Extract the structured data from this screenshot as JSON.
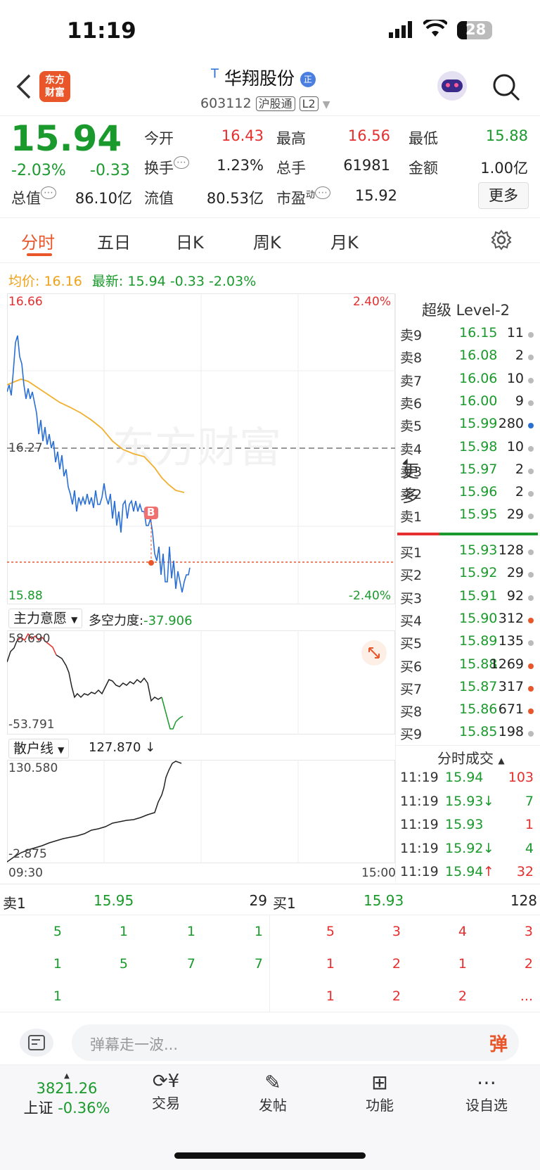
{
  "status_bar": {
    "time": "11:19",
    "battery": "28"
  },
  "header": {
    "title_prefix": "T",
    "title": "华翔股份",
    "badge": "正",
    "code": "603112",
    "tag1": "沪股通",
    "tag2": "L2",
    "logo_line1": "东方",
    "logo_line2": "财富"
  },
  "quote": {
    "price": "15.94",
    "change_pct": "-2.03%",
    "change": "-0.33",
    "open_label": "今开",
    "open": "16.43",
    "high_label": "最高",
    "high": "16.56",
    "low_label": "最低",
    "low": "15.88",
    "turnover_label": "换手",
    "turnover": "1.23%",
    "volume_label": "总手",
    "volume": "61981",
    "amount_label": "金额",
    "amount": "1.00亿",
    "mcap_label": "总值",
    "mcap": "86.10亿",
    "float_label": "流值",
    "float": "80.53亿",
    "pe_label": "市盈",
    "pe_sup": "动",
    "pe": "15.92",
    "more_button": "更多"
  },
  "tabs": [
    "分时",
    "五日",
    "日K",
    "周K",
    "月K",
    "更多"
  ],
  "chart_info": {
    "avg_label": "均价:",
    "avg": "16.16",
    "latest_label": "最新:",
    "latest": "15.94",
    "change": "-0.33",
    "change_pct": "-2.03%",
    "y_top": "16.66",
    "y_mid": "16.27",
    "y_bottom": "15.88",
    "pct_top": "2.40%",
    "pct_bottom": "-2.40%",
    "watermark": "东方财富",
    "buy_marker": "B",
    "x_start": "09:30",
    "x_end": "15:00"
  },
  "indicator1": {
    "name": "主力意愿",
    "label": "多空力度:",
    "value": "-37.906",
    "y_top": "58.690",
    "y_bottom": "-53.791"
  },
  "indicator2": {
    "name": "散户线",
    "value": "127.870 ↓",
    "y_top": "130.580",
    "y_bottom": "-2.875"
  },
  "order_book": {
    "title": "超级 Level-2",
    "asks": [
      {
        "label": "卖9",
        "price": "16.15",
        "vol": "11",
        "dot": "#bbbbbb"
      },
      {
        "label": "卖8",
        "price": "16.08",
        "vol": "2",
        "dot": "#bbbbbb"
      },
      {
        "label": "卖7",
        "price": "16.06",
        "vol": "10",
        "dot": "#bbbbbb"
      },
      {
        "label": "卖6",
        "price": "16.00",
        "vol": "9",
        "dot": "#bbbbbb"
      },
      {
        "label": "卖5",
        "price": "15.99",
        "vol": "280",
        "dot": "#2a6fd6"
      },
      {
        "label": "卖4",
        "price": "15.98",
        "vol": "10",
        "dot": "#bbbbbb"
      },
      {
        "label": "卖3",
        "price": "15.97",
        "vol": "2",
        "dot": "#bbbbbb"
      },
      {
        "label": "卖2",
        "price": "15.96",
        "vol": "2",
        "dot": "#bbbbbb"
      },
      {
        "label": "卖1",
        "price": "15.95",
        "vol": "29",
        "dot": "#bbbbbb"
      }
    ],
    "bids": [
      {
        "label": "买1",
        "price": "15.93",
        "vol": "128",
        "dot": "#bbbbbb"
      },
      {
        "label": "买2",
        "price": "15.92",
        "vol": "29",
        "dot": "#bbbbbb"
      },
      {
        "label": "买3",
        "price": "15.91",
        "vol": "92",
        "dot": "#bbbbbb"
      },
      {
        "label": "买4",
        "price": "15.90",
        "vol": "312",
        "dot": "#e8562a"
      },
      {
        "label": "买5",
        "price": "15.89",
        "vol": "135",
        "dot": "#bbbbbb"
      },
      {
        "label": "买6",
        "price": "15.88",
        "vol": "1269",
        "dot": "#e8562a"
      },
      {
        "label": "买7",
        "price": "15.87",
        "vol": "317",
        "dot": "#e8562a"
      },
      {
        "label": "买8",
        "price": "15.86",
        "vol": "671",
        "dot": "#e8562a"
      },
      {
        "label": "买9",
        "price": "15.85",
        "vol": "198",
        "dot": "#bbbbbb"
      }
    ]
  },
  "trades": {
    "title": "分时成交",
    "rows": [
      {
        "time": "11:19",
        "price": "15.94",
        "arrow": "",
        "vol": "103",
        "vol_color": "red"
      },
      {
        "time": "11:19",
        "price": "15.93",
        "arrow": "↓",
        "vol": "7",
        "vol_color": "green"
      },
      {
        "time": "11:19",
        "price": "15.93",
        "arrow": "",
        "vol": "1",
        "vol_color": "red"
      },
      {
        "time": "11:19",
        "price": "15.92",
        "arrow": "↓",
        "vol": "4",
        "vol_color": "green"
      },
      {
        "time": "11:19",
        "price": "15.94",
        "arrow": "↑",
        "vol": "32",
        "vol_color": "red"
      }
    ]
  },
  "queue": {
    "sell_label": "卖1",
    "sell_price": "15.95",
    "sell_total": "29",
    "buy_label": "买1",
    "buy_price": "15.93",
    "buy_total": "128",
    "sell_rows": [
      [
        "5",
        "1",
        "1",
        "1"
      ],
      [
        "1",
        "5",
        "7",
        "7"
      ],
      [
        "1",
        "",
        "",
        ""
      ]
    ],
    "buy_rows": [
      [
        "5",
        "3",
        "4",
        "3"
      ],
      [
        "1",
        "2",
        "1",
        "2"
      ],
      [
        "1",
        "2",
        "2",
        "..."
      ]
    ]
  },
  "comment": {
    "placeholder": "弹幕走一波...",
    "danmu_btn": "弹"
  },
  "bottom_nav": {
    "index_value": "3821.26",
    "index_name": "上证",
    "index_change": "-0.36%",
    "items": [
      "交易",
      "发帖",
      "功能",
      "设自选"
    ]
  }
}
